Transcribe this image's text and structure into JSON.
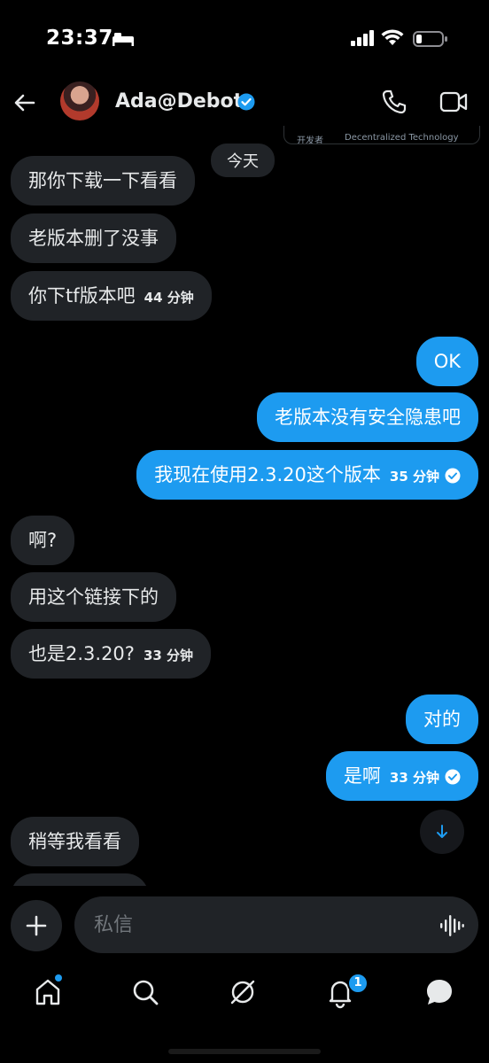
{
  "status": {
    "time": "23:37"
  },
  "header": {
    "name": "Ada@Debot"
  },
  "peek": {
    "left": "开发者",
    "right": "Decentralized Technology"
  },
  "chat": {
    "today_label": "今天",
    "m1": "那你下载一下看看",
    "m2": "老版本删了没事",
    "m3": "你下tf版本吧",
    "m3_time": "44 分钟",
    "m4": "OK",
    "m5": "老版本没有安全隐患吧",
    "m6": "我现在使用2.3.20这个版本",
    "m6_time": "35 分钟",
    "m7": "啊?",
    "m8": "用这个链接下的",
    "m9": "也是2.3.20?",
    "m9_time": "33 分钟",
    "m10": "对的",
    "m11": "是啊",
    "m11_time": "33 分钟",
    "m12": "稍等我看看"
  },
  "composer": {
    "placeholder": "私信"
  },
  "nav": {
    "notifications_badge": "1"
  },
  "colors": {
    "accent": "#1d9bf0",
    "bubble_in": "#202327",
    "background": "#000000"
  }
}
